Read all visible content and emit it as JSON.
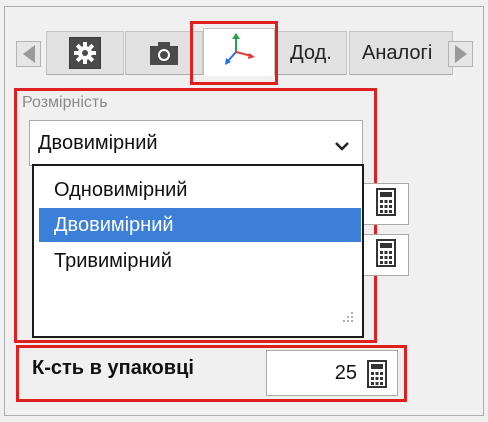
{
  "tabs": {
    "items": [
      {
        "name": "settings",
        "icon": "gear-icon"
      },
      {
        "name": "camera",
        "icon": "camera-icon"
      },
      {
        "name": "axes",
        "icon": "axes-icon",
        "active": true
      },
      {
        "name": "extra",
        "label": "Дод."
      },
      {
        "name": "analog",
        "label": "Аналогі"
      }
    ],
    "scroll_left_icon": "triangle-left-icon",
    "scroll_right_icon": "triangle-right-icon"
  },
  "dimension": {
    "label": "Розмірність",
    "selected": "Двовимірний",
    "options": [
      "Одновимірний",
      "Двовимірний",
      "Тривимірний"
    ],
    "selected_index": 1
  },
  "package": {
    "label": "К-сть в упаковці",
    "value": "25"
  },
  "colors": {
    "highlight": "#e02020",
    "selection": "#3b7fd8"
  }
}
